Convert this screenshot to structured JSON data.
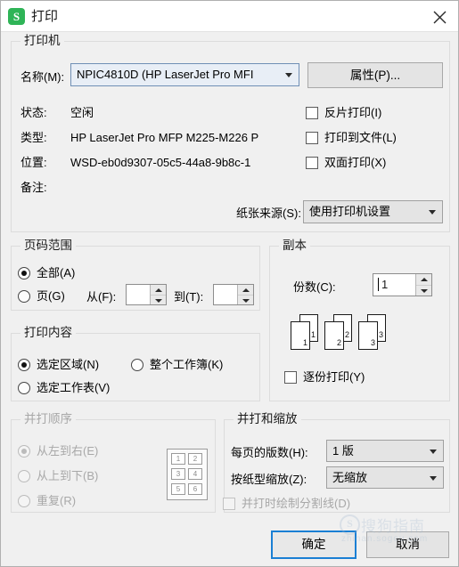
{
  "window": {
    "title": "打印",
    "app_icon_letter": "S",
    "close_icon": "close-icon"
  },
  "printer": {
    "legend": "打印机",
    "name_label": "名称(M):",
    "name_value": "NPIC4810D (HP LaserJet Pro MFI",
    "properties_button": "属性(P)...",
    "status_label": "状态:",
    "status_value": "空闲",
    "type_label": "类型:",
    "type_value": "HP LaserJet Pro MFP M225-M226 P",
    "location_label": "位置:",
    "location_value": "WSD-eb0d9307-05c5-44a8-9b8c-1",
    "comment_label": "备注:",
    "comment_value": "",
    "paper_source_label": "纸张来源(S):",
    "paper_source_value": "使用打印机设置",
    "options": [
      {
        "label": "反片打印(I)",
        "checked": false
      },
      {
        "label": "打印到文件(L)",
        "checked": false
      },
      {
        "label": "双面打印(X)",
        "checked": false
      }
    ]
  },
  "page_range": {
    "legend": "页码范围",
    "all_label": "全部(A)",
    "all_selected": true,
    "pages_label": "页(G)",
    "pages_selected": false,
    "from_label": "从(F):",
    "from_value": "",
    "to_label": "到(T):",
    "to_value": ""
  },
  "copies": {
    "legend": "副本",
    "count_label": "份数(C):",
    "count_value": "1",
    "illustration": [
      "1",
      "2",
      "3"
    ],
    "collate_label": "逐份打印(Y)",
    "collate_checked": false
  },
  "print_content": {
    "legend": "打印内容",
    "options": [
      {
        "label": "选定区域(N)",
        "selected": true
      },
      {
        "label": "整个工作簿(K)",
        "selected": false
      },
      {
        "label": "选定工作表(V)",
        "selected": false
      }
    ]
  },
  "order": {
    "legend": "并打顺序",
    "disabled": true,
    "options": [
      {
        "label": "从左到右(E)",
        "selected": true
      },
      {
        "label": "从上到下(B)",
        "selected": false
      },
      {
        "label": "重复(R)",
        "selected": false
      }
    ],
    "preview_cells": [
      "1",
      "2",
      "3",
      "4",
      "5",
      "6"
    ]
  },
  "zoom": {
    "legend": "并打和缩放",
    "pages_per_sheet_label": "每页的版数(H):",
    "pages_per_sheet_value": "1 版",
    "scale_label": "按纸型缩放(Z):",
    "scale_value": "无缩放",
    "divider_label": "并打时绘制分割线(D)",
    "divider_checked": false,
    "divider_disabled": true
  },
  "footer": {
    "ok_button": "确定",
    "cancel_button": "取消"
  },
  "watermark": {
    "logo_letter": "S",
    "cn": "搜狗指南",
    "en": "zhinan.sogou.com"
  },
  "colors": {
    "accent": "#1a7fd4",
    "app_icon": "#2fb457",
    "dialog_bg": "#f0f0f0"
  }
}
